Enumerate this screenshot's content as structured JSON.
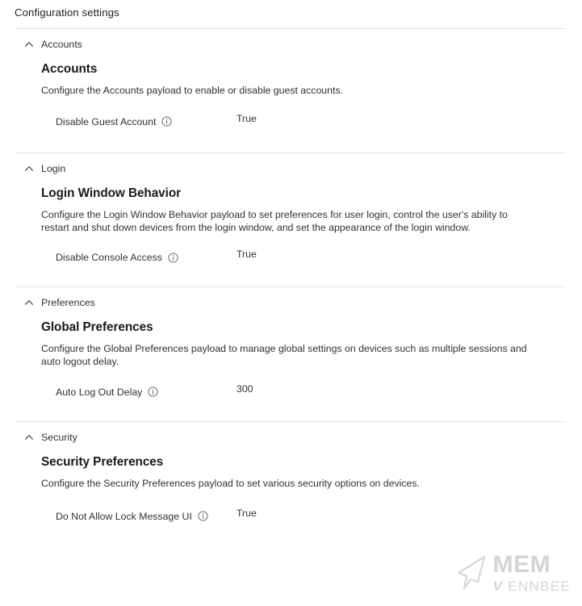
{
  "header": {
    "title": "Configuration settings"
  },
  "sections": [
    {
      "name": "Accounts",
      "chevron": "chevron-up-icon",
      "payload_title": "Accounts",
      "payload_description": "Configure the Accounts payload to enable or disable guest accounts.",
      "settings": [
        {
          "label": "Disable Guest Account",
          "info": "info-icon",
          "value": "True"
        }
      ]
    },
    {
      "name": "Login",
      "chevron": "chevron-up-icon",
      "payload_title": "Login Window Behavior",
      "payload_description": "Configure the Login Window Behavior payload to set preferences for user login, control the user's ability to restart and shut down devices from the login window, and set the appearance of the login window.",
      "settings": [
        {
          "label": "Disable Console Access",
          "info": "info-icon",
          "value": "True"
        }
      ]
    },
    {
      "name": "Preferences",
      "chevron": "chevron-up-icon",
      "payload_title": "Global Preferences",
      "payload_description": "Configure the Global Preferences payload to manage global settings on devices such as multiple sessions and auto logout delay.",
      "settings": [
        {
          "label": "Auto Log Out Delay",
          "info": "info-icon",
          "value": "300"
        }
      ]
    },
    {
      "name": "Security",
      "chevron": "chevron-up-icon",
      "payload_title": "Security Preferences",
      "payload_description": "Configure the Security Preferences payload to set various security options on devices.",
      "settings": [
        {
          "label": "Do Not Allow Lock Message UI",
          "info": "info-icon",
          "value": "True"
        }
      ]
    }
  ],
  "watermark": {
    "line1": "MEM",
    "line2_prefix": "V",
    "line2": "ENNBEE",
    "logo": "cursor-arrow-icon"
  },
  "colors": {
    "page_background": "#ffffff",
    "text_primary": "#323130",
    "heading": "#1b1a19",
    "divider": "#e6e4e2",
    "icon_muted": "#605e5c",
    "watermark": "#d4d4d4"
  }
}
